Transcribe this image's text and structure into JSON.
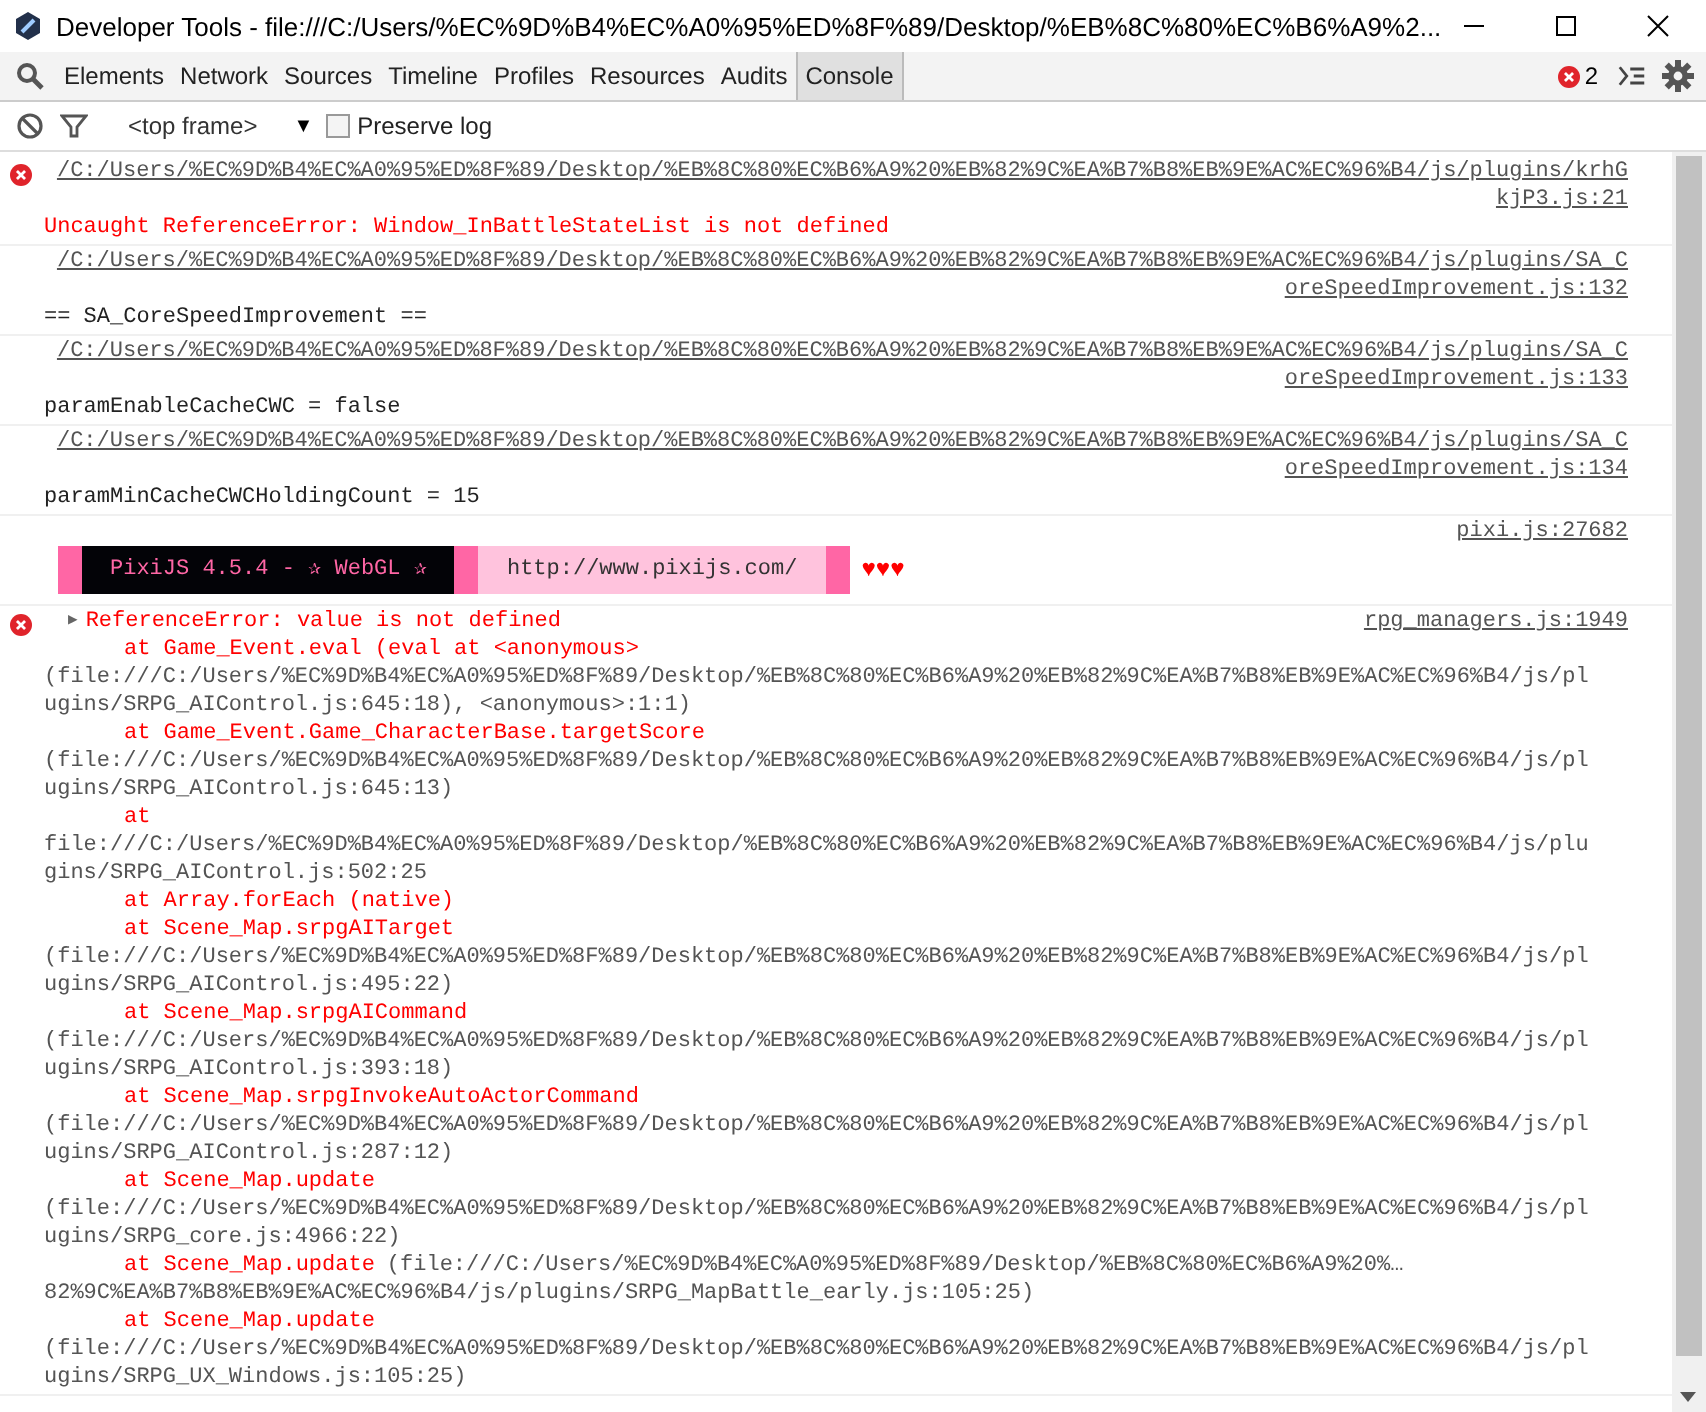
{
  "window": {
    "title": "Developer Tools - file:///C:/Users/%EC%9D%B4%EC%A0%95%ED%8F%89/Desktop/%EB%8C%80%EC%B6%A9%2..."
  },
  "tabs": [
    {
      "label": "Elements",
      "selected": false
    },
    {
      "label": "Network",
      "selected": false
    },
    {
      "label": "Sources",
      "selected": false
    },
    {
      "label": "Timeline",
      "selected": false
    },
    {
      "label": "Profiles",
      "selected": false
    },
    {
      "label": "Resources",
      "selected": false
    },
    {
      "label": "Audits",
      "selected": false
    },
    {
      "label": "Console",
      "selected": true
    }
  ],
  "error_count": "2",
  "filter_bar": {
    "context": "<top frame>",
    "dropdown_arrow": "▼",
    "preserve_log": {
      "label": "Preserve log",
      "checked": false
    }
  },
  "entries": [
    {
      "kind": "error",
      "source_lines": [
        "/C:/Users/%EC%9D%B4%EC%A0%95%ED%8F%89/Desktop/%EB%8C%80%EC%B6%A9%20%EB%82%9C%EA%B7%B8%EB%9E%AC%EC%96%B4/js/plugins/krhG",
        "kjP3.js:21"
      ],
      "message": "Uncaught ReferenceError: Window_InBattleStateList is not defined"
    },
    {
      "kind": "log",
      "source_lines": [
        "/C:/Users/%EC%9D%B4%EC%A0%95%ED%8F%89/Desktop/%EB%8C%80%EC%B6%A9%20%EB%82%9C%EA%B7%B8%EB%9E%AC%EC%96%B4/js/plugins/SA_C",
        "oreSpeedImprovement.js:132"
      ],
      "message": "== SA_CoreSpeedImprovement =="
    },
    {
      "kind": "log",
      "source_lines": [
        "/C:/Users/%EC%9D%B4%EC%A0%95%ED%8F%89/Desktop/%EB%8C%80%EC%B6%A9%20%EB%82%9C%EA%B7%B8%EB%9E%AC%EC%96%B4/js/plugins/SA_C",
        "oreSpeedImprovement.js:133"
      ],
      "message": "paramEnableCacheCWC = false"
    },
    {
      "kind": "log",
      "source_lines": [
        "/C:/Users/%EC%9D%B4%EC%A0%95%ED%8F%89/Desktop/%EB%8C%80%EC%B6%A9%20%EB%82%9C%EA%B7%B8%EB%9E%AC%EC%96%B4/js/plugins/SA_C",
        "oreSpeedImprovement.js:134"
      ],
      "message": "paramMinCacheCWCHoldingCount = 15"
    },
    {
      "kind": "banner",
      "source_lines": [
        "pixi.js:27682"
      ],
      "banner": {
        "name": "PixiJS 4.5.4 - ✰ WebGL ✰",
        "url": "http://www.pixijs.com/",
        "hearts": "♥♥♥"
      }
    },
    {
      "kind": "trace",
      "source_lines": [
        "rpg_managers.js:1949"
      ],
      "disclosure": "▶",
      "message": "ReferenceError: value is not defined",
      "stack": [
        {
          "call": "at Game_Event.eval (eval at <anonymous>"
        },
        {
          "location": "(file:///C:/Users/%EC%9D%B4%EC%A0%95%ED%8F%89/Desktop/%EB%8C%80%EC%B6%A9%20%EB%82%9C%EA%B7%B8%EB%9E%AC%EC%96%B4/js/pl"
        },
        {
          "location": "ugins/SRPG_AIControl.js:645:18), <anonymous>:1:1)"
        },
        {
          "call": "at Game_Event.Game_CharacterBase.targetScore"
        },
        {
          "location": "(file:///C:/Users/%EC%9D%B4%EC%A0%95%ED%8F%89/Desktop/%EB%8C%80%EC%B6%A9%20%EB%82%9C%EA%B7%B8%EB%9E%AC%EC%96%B4/js/pl"
        },
        {
          "location": "ugins/SRPG_AIControl.js:645:13)"
        },
        {
          "call": "at"
        },
        {
          "location": "file:///C:/Users/%EC%9D%B4%EC%A0%95%ED%8F%89/Desktop/%EB%8C%80%EC%B6%A9%20%EB%82%9C%EA%B7%B8%EB%9E%AC%EC%96%B4/js/plu"
        },
        {
          "location": "gins/SRPG_AIControl.js:502:25"
        },
        {
          "call": "at Array.forEach (native)"
        },
        {
          "call": "at Scene_Map.srpgAITarget"
        },
        {
          "location": "(file:///C:/Users/%EC%9D%B4%EC%A0%95%ED%8F%89/Desktop/%EB%8C%80%EC%B6%A9%20%EB%82%9C%EA%B7%B8%EB%9E%AC%EC%96%B4/js/pl"
        },
        {
          "location": "ugins/SRPG_AIControl.js:495:22)"
        },
        {
          "call": "at Scene_Map.srpgAICommand"
        },
        {
          "location": "(file:///C:/Users/%EC%9D%B4%EC%A0%95%ED%8F%89/Desktop/%EB%8C%80%EC%B6%A9%20%EB%82%9C%EA%B7%B8%EB%9E%AC%EC%96%B4/js/pl"
        },
        {
          "location": "ugins/SRPG_AIControl.js:393:18)"
        },
        {
          "call": "at Scene_Map.srpgInvokeAutoActorCommand"
        },
        {
          "location": "(file:///C:/Users/%EC%9D%B4%EC%A0%95%ED%8F%89/Desktop/%EB%8C%80%EC%B6%A9%20%EB%82%9C%EA%B7%B8%EB%9E%AC%EC%96%B4/js/pl"
        },
        {
          "location": "ugins/SRPG_AIControl.js:287:12)"
        },
        {
          "call": "at Scene_Map.update"
        },
        {
          "location": "(file:///C:/Users/%EC%9D%B4%EC%A0%95%ED%8F%89/Desktop/%EB%8C%80%EC%B6%A9%20%EB%82%9C%EA%B7%B8%EB%9E%AC%EC%96%B4/js/pl"
        },
        {
          "location": "ugins/SRPG_core.js:4966:22)"
        },
        {
          "call": "at Scene_Map.update",
          "location": "(file:///C:/Users/%EC%9D%B4%EC%A0%95%ED%8F%89/Desktop/%EB%8C%80%EC%B6%A9%20%…"
        },
        {
          "location": "82%9C%EA%B7%B8%EB%9E%AC%EC%96%B4/js/plugins/SRPG_MapBattle_early.js:105:25)"
        },
        {
          "call": "at Scene_Map.update"
        },
        {
          "location": "(file:///C:/Users/%EC%9D%B4%EC%A0%95%ED%8F%89/Desktop/%EB%8C%80%EC%B6%A9%20%EB%82%9C%EA%B7%B8%EB%9E%AC%EC%96%B4/js/pl"
        },
        {
          "location": "ugins/SRPG_UX_Windows.js:105:25)"
        }
      ]
    }
  ]
}
